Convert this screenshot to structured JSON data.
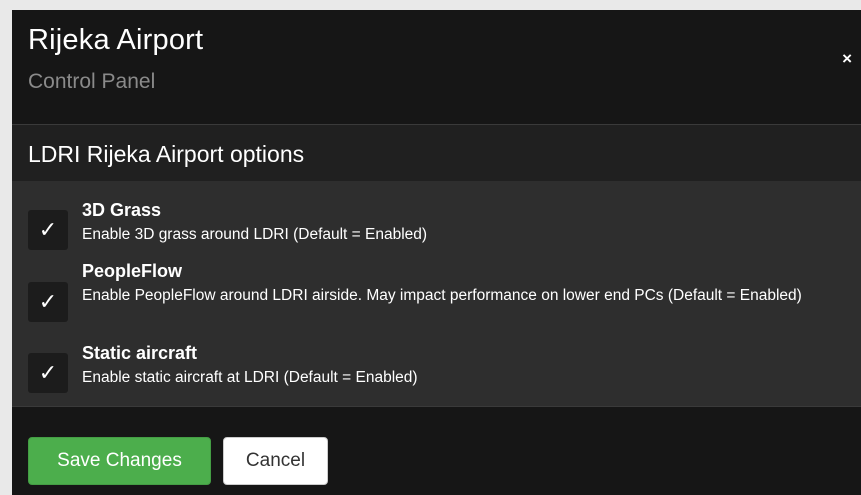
{
  "header": {
    "title": "Rijeka Airport",
    "subtitle": "Control Panel",
    "close_glyph": "×"
  },
  "section": {
    "title": "LDRI Rijeka Airport options"
  },
  "options": [
    {
      "name": "3D Grass",
      "description": "Enable 3D grass around LDRI (Default = Enabled)",
      "checked": true,
      "check_glyph": "✓"
    },
    {
      "name": "PeopleFlow",
      "description": "Enable PeopleFlow around LDRI airside. May impact performance on lower end PCs (Default = Enabled)",
      "checked": true,
      "check_glyph": "✓"
    },
    {
      "name": "Static aircraft",
      "description": "Enable static aircraft at LDRI (Default = Enabled)",
      "checked": true,
      "check_glyph": "✓"
    }
  ],
  "footer": {
    "save_label": "Save Changes",
    "cancel_label": "Cancel"
  },
  "colors": {
    "save_button": "#4cae4c",
    "panel_background": "#161616",
    "options_background": "#2e2e2e",
    "subtitle_text": "#8a8a8a"
  },
  "icons": {
    "close": "close-icon",
    "checkmark": "checkmark-icon"
  }
}
